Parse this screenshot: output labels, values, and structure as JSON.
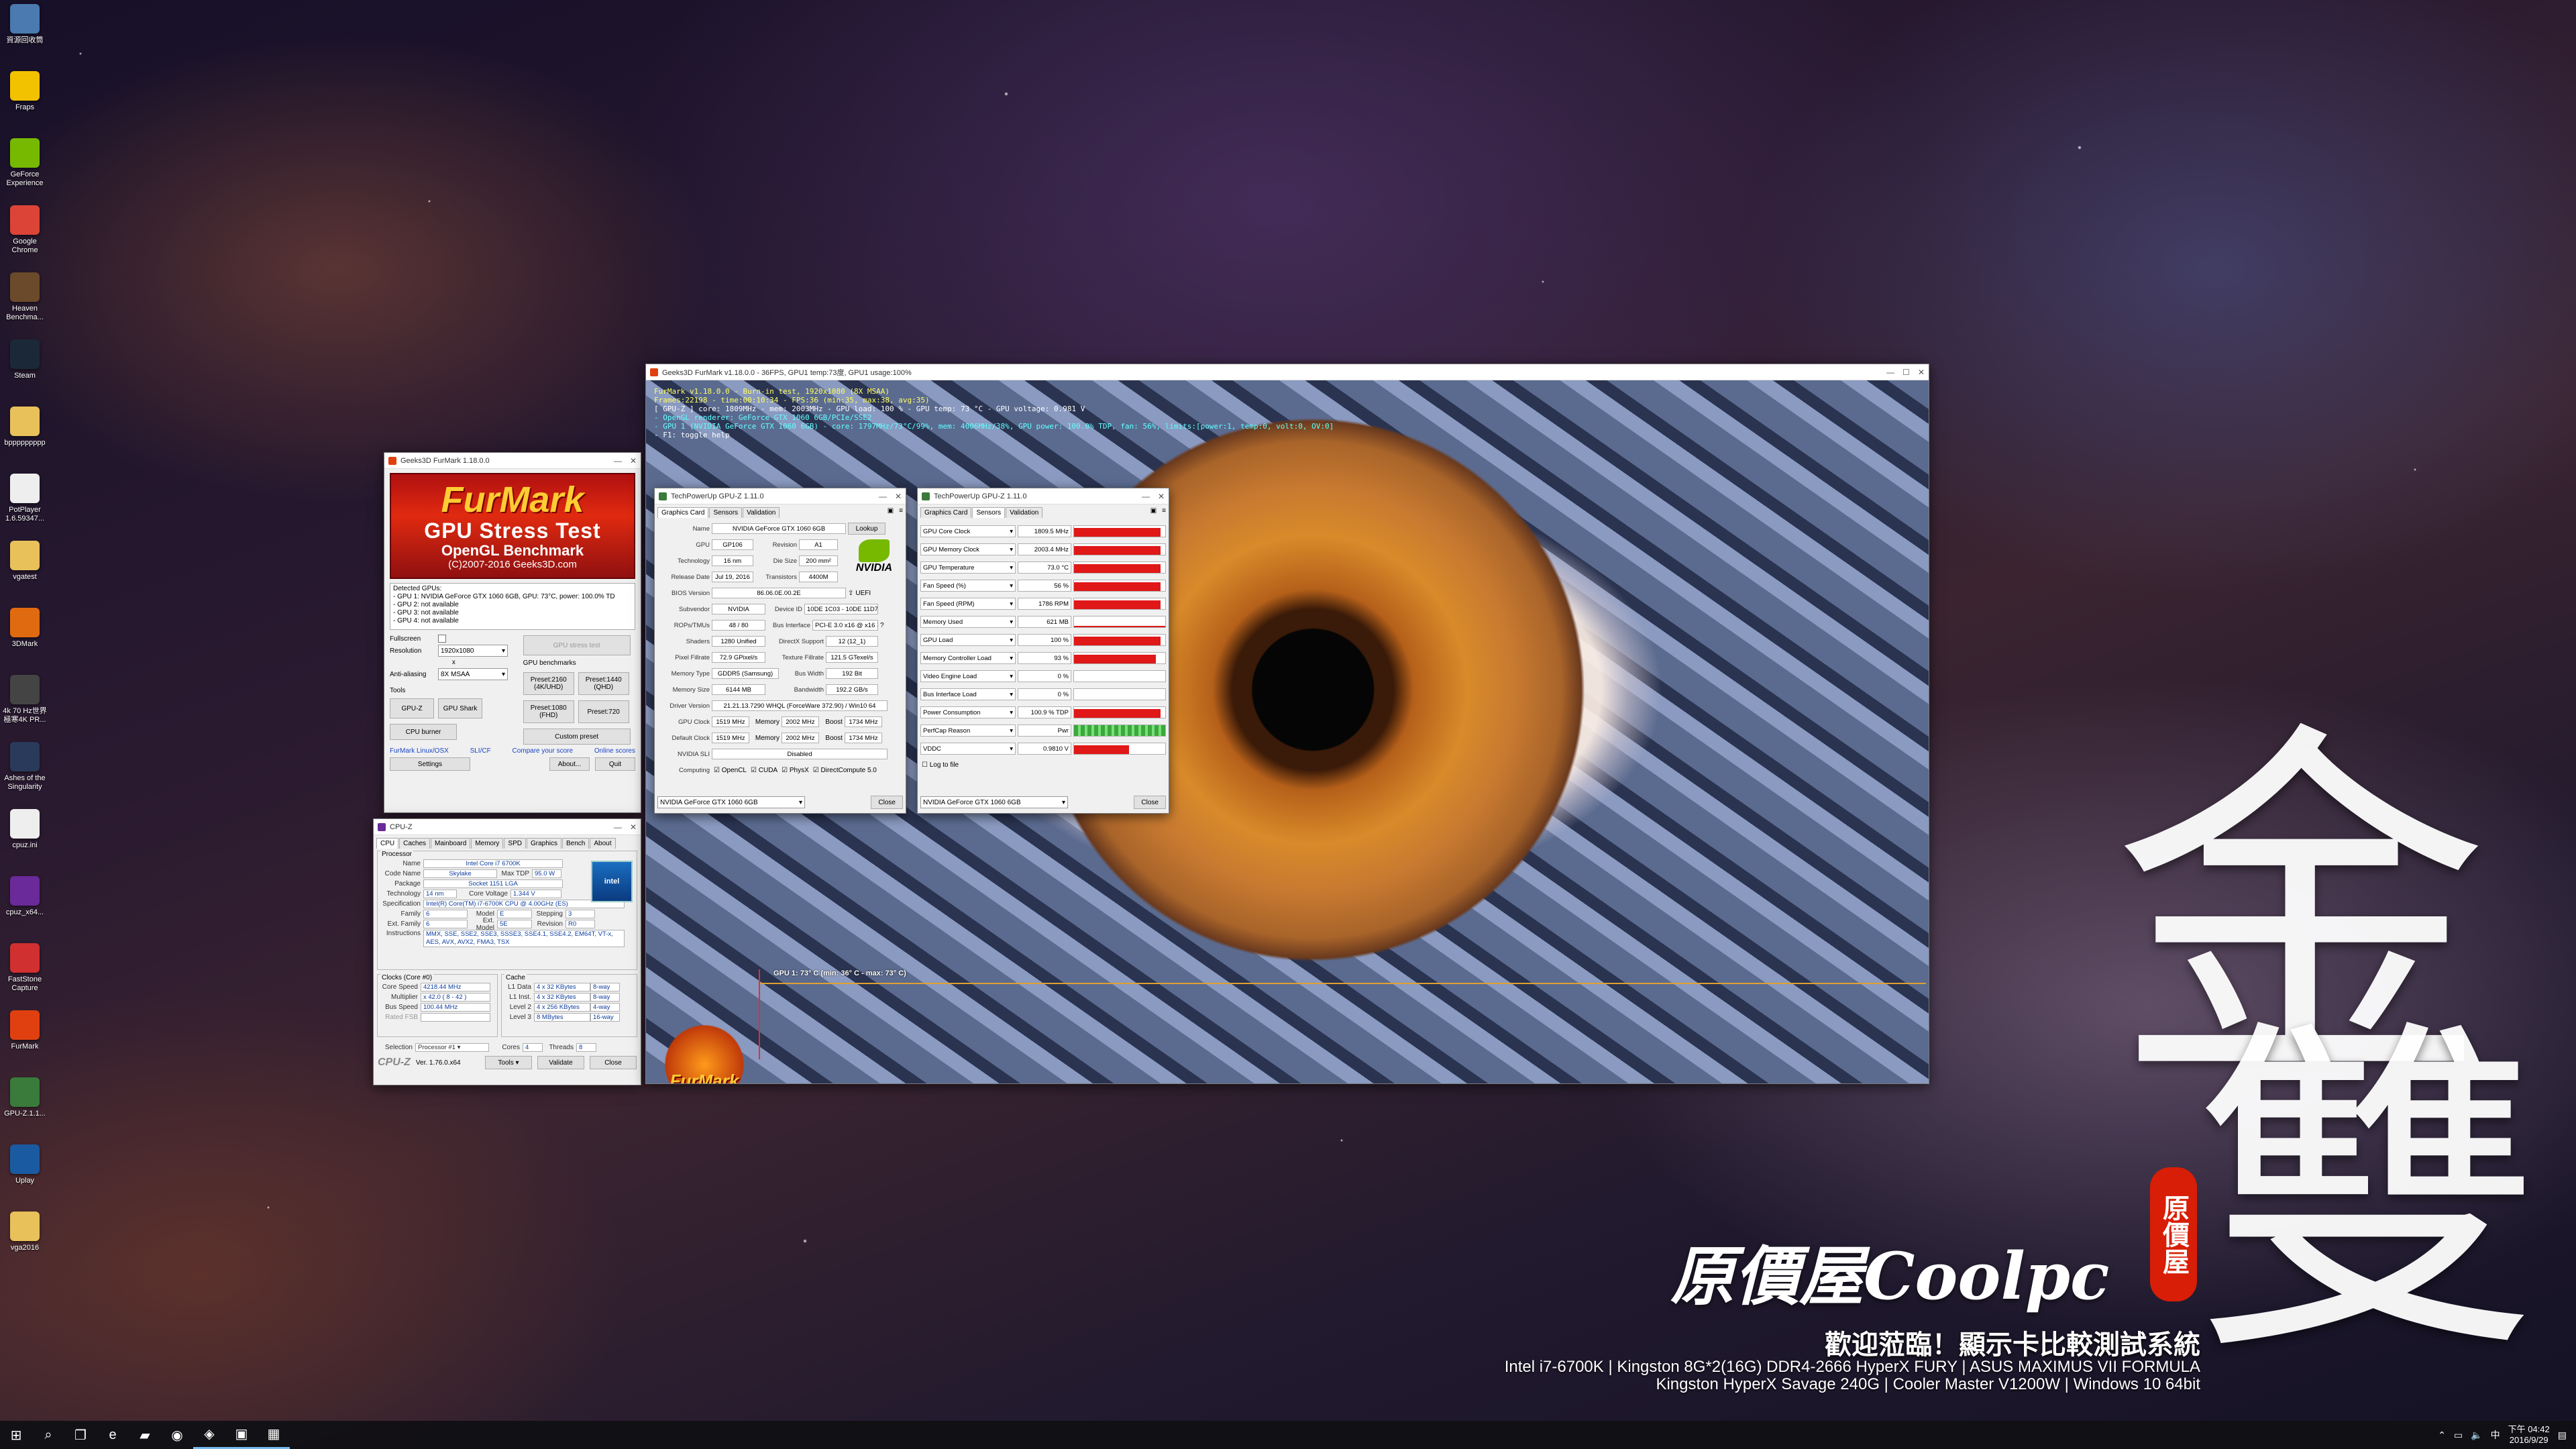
{
  "desktop_icons": [
    {
      "label": "資源回收筒",
      "icon": "recycle-bin-icon",
      "color": "#4a7ab0"
    },
    {
      "label": "Fraps",
      "icon": "fraps-icon",
      "color": "#f2c200"
    },
    {
      "label": "GeForce Experience",
      "icon": "geforce-icon",
      "color": "#76b900"
    },
    {
      "label": "Google Chrome",
      "icon": "chrome-icon",
      "color": "#db4437"
    },
    {
      "label": "Heaven Benchma...",
      "icon": "heaven-icon",
      "color": "#6a4a2a"
    },
    {
      "label": "Steam",
      "icon": "steam-icon",
      "color": "#1b2838"
    },
    {
      "label": "bppppppppp",
      "icon": "folder-icon",
      "color": "#e8c15a"
    },
    {
      "label": "PotPlayer 1.6.59347...",
      "icon": "file-icon",
      "color": "#eeeeee"
    },
    {
      "label": "vgatest",
      "icon": "folder-icon",
      "color": "#e8c15a"
    },
    {
      "label": "3DMark",
      "icon": "3dmark-icon",
      "color": "#e06a10"
    },
    {
      "label": "4k 70 Hz世界 極寒4K PR...",
      "icon": "video-icon",
      "color": "#444444"
    },
    {
      "label": "Ashes of the Singularity",
      "icon": "ashes-icon",
      "color": "#2a3a5a"
    },
    {
      "label": "cpuz.ini",
      "icon": "file-icon",
      "color": "#eeeeee"
    },
    {
      "label": "cpuz_x64...",
      "icon": "cpuz-icon",
      "color": "#6a2a9a"
    },
    {
      "label": "FastStone Capture",
      "icon": "faststone-icon",
      "color": "#d03030"
    },
    {
      "label": "FurMark",
      "icon": "furmark-icon",
      "color": "#e04010"
    },
    {
      "label": "GPU-Z.1.1...",
      "icon": "gpuz-icon",
      "color": "#3a7a3a"
    },
    {
      "label": "Uplay",
      "icon": "uplay-icon",
      "color": "#1a5aa0"
    },
    {
      "label": "vga2016",
      "icon": "folder-icon",
      "color": "#e8c15a"
    }
  ],
  "furmark_launcher": {
    "title": "Geeks3D FurMark 1.18.0.0",
    "banner": {
      "line1": "FurMark",
      "line2": "GPU Stress Test",
      "line3": "OpenGL Benchmark",
      "line4": "(C)2007-2016 Geeks3D.com"
    },
    "gpus_header": "Detected GPUs:",
    "gpus": [
      "- GPU 1: NVIDIA GeForce GTX 1060 6GB, GPU: 73°C, power: 100.0% TD",
      "- GPU 2: not available",
      "- GPU 3: not available",
      "- GPU 4: not available"
    ],
    "fullscreen_label": "Fullscreen",
    "resolution_label": "Resolution",
    "resolution_value": "1920x1080",
    "x_label": "x",
    "antialiasing_label": "Anti-aliasing",
    "antialiasing_value": "8X MSAA",
    "tools_label": "Tools",
    "gpu_stress_test": "GPU stress test",
    "gpu_benchmarks_label": "GPU benchmarks",
    "preset_2160": "Preset:2160 (4K/UHD)",
    "preset_1440": "Preset:1440 (QHD)",
    "preset_1080": "Preset:1080 (FHD)",
    "preset_720": "Preset:720",
    "custom_preset": "Custom preset",
    "gpuz_btn": "GPU-Z",
    "gpushark_btn": "GPU Shark",
    "cpuburner_btn": "CPU burner",
    "links": [
      "FurMark Linux/OSX",
      "SLI/CF",
      "Compare your score",
      "Online scores"
    ],
    "settings_btn": "Settings",
    "about_btn": "About...",
    "quit_btn": "Quit"
  },
  "cpuz": {
    "title": "CPU-Z",
    "tabs": [
      "CPU",
      "Caches",
      "Mainboard",
      "Memory",
      "SPD",
      "Graphics",
      "Bench",
      "About"
    ],
    "processor_label": "Processor",
    "name_label": "Name",
    "name": "Intel Core i7 6700K",
    "codename_label": "Code Name",
    "codename": "Skylake",
    "maxtdp_label": "Max TDP",
    "maxtdp": "95.0 W",
    "package_label": "Package",
    "package": "Socket 1151 LGA",
    "technology_label": "Technology",
    "technology": "14 nm",
    "corevoltage_label": "Core Voltage",
    "corevoltage": "1.344 V",
    "spec_label": "Specification",
    "spec": "Intel(R) Core(TM) i7-6700K CPU @ 4.00GHz (ES)",
    "family_label": "Family",
    "family": "6",
    "model_label": "Model",
    "model": "E",
    "stepping_label": "Stepping",
    "stepping": "3",
    "extfamily_label": "Ext. Family",
    "extfamily": "6",
    "extmodel_label": "Ext. Model",
    "extmodel": "5E",
    "revision_label": "Revision",
    "revision": "R0",
    "instructions_label": "Instructions",
    "instructions": "MMX, SSE, SSE2, SSE3, SSSE3, SSE4.1, SSE4.2, EM64T, VT-x, AES, AVX, AVX2, FMA3, TSX",
    "clocks_label": "Clocks (Core #0)",
    "corespeed_label": "Core Speed",
    "corespeed": "4218.44 MHz",
    "multiplier_label": "Multiplier",
    "multiplier": "x 42.0 ( 8 - 42 )",
    "busspeed_label": "Bus Speed",
    "busspeed": "100.44 MHz",
    "ratedfsb_label": "Rated FSB",
    "cache_label": "Cache",
    "l1d_label": "L1 Data",
    "l1d": "4 x 32 KBytes",
    "l1d_way": "8-way",
    "l1i_label": "L1 Inst.",
    "l1i": "4 x 32 KBytes",
    "l1i_way": "8-way",
    "l2_label": "Level 2",
    "l2": "4 x 256 KBytes",
    "l2_way": "4-way",
    "l3_label": "Level 3",
    "l3": "8 MBytes",
    "l3_way": "16-way",
    "selection_label": "Selection",
    "selection": "Processor #1",
    "cores_label": "Cores",
    "cores": "4",
    "threads_label": "Threads",
    "threads": "8",
    "brand": "CPU-Z",
    "version": "Ver. 1.76.0.x64",
    "tools_btn": "Tools",
    "validate_btn": "Validate",
    "close_btn": "Close"
  },
  "render": {
    "title": "Geeks3D FurMark v1.18.0.0 - 36FPS, GPU1 temp:73度, GPU1 usage:100%",
    "osd": [
      {
        "text": "FurMark v1.18.0.0 - Burn-in test, 1920x1080 (8X MSAA)",
        "color": "#ffff60"
      },
      {
        "text": "Frames:22198 - time:00:10:34 - FPS:36 (min:35, max:38, avg:35)",
        "color": "#ffff60"
      },
      {
        "text": "[ GPU-Z ] core: 1809MHz - mem: 2003MHz - GPU load: 100 % - GPU temp: 73 °C - GPU voltage: 0.981 V",
        "color": "#ffffff"
      },
      {
        "text": "- OpenGL renderer: GeForce GTX 1060 6GB/PCIe/SSE2",
        "color": "#60ffff"
      },
      {
        "text": "- GPU 1 (NVIDIA GeForce GTX 1060 6GB) - core: 1797MHz/73°C/99%, mem: 4006MHz/38%, GPU power: 100.0% TDP, fan: 56%, limits:[power:1, temp:0, volt:0, OV:0]",
        "color": "#60ffff"
      },
      {
        "text": "- F1: toggle help",
        "color": "#ffffff"
      }
    ],
    "graph_label": "GPU 1: 73° C (min: 36° C - max: 73° C)",
    "logo_text": "FurMark"
  },
  "gpuz_card": {
    "title": "TechPowerUp GPU-Z 1.11.0",
    "tabs": [
      "Graphics Card",
      "Sensors",
      "Validation"
    ],
    "name_label": "Name",
    "name": "NVIDIA GeForce GTX 1060 6GB",
    "lookup_btn": "Lookup",
    "gpu_label": "GPU",
    "gpu": "GP106",
    "revision_label": "Revision",
    "revision": "A1",
    "tech_label": "Technology",
    "tech": "16 nm",
    "diesize_label": "Die Size",
    "diesize": "200 mm²",
    "release_label": "Release Date",
    "release": "Jul 19, 2016",
    "transistors_label": "Transistors",
    "transistors": "4400M",
    "bios_label": "BIOS Version",
    "bios": "86.06.0E.00.2E",
    "uefi_label": "UEFI",
    "subvendor_label": "Subvendor",
    "subvendor": "NVIDIA",
    "deviceid_label": "Device ID",
    "deviceid": "10DE 1C03 - 10DE 11D7",
    "rops_label": "ROPs/TMUs",
    "rops": "48 / 80",
    "businterface_label": "Bus Interface",
    "businterface": "PCI-E 3.0 x16 @ x16 3.0",
    "shaders_label": "Shaders",
    "shaders": "1280 Unified",
    "directx_label": "DirectX Support",
    "directx": "12 (12_1)",
    "pixel_label": "Pixel Fillrate",
    "pixel": "72.9 GPixel/s",
    "texture_label": "Texture Fillrate",
    "texture": "121.5 GTexel/s",
    "memtype_label": "Memory Type",
    "memtype": "GDDR5 (Samsung)",
    "buswidth_label": "Bus Width",
    "buswidth": "192 Bit",
    "memsize_label": "Memory Size",
    "memsize": "6144 MB",
    "bandwidth_label": "Bandwidth",
    "bandwidth": "192.2 GB/s",
    "driver_label": "Driver Version",
    "driver": "21.21.13.7290 WHQL (ForceWare 372.90) / Win10 64",
    "gpuclock_label": "GPU Clock",
    "gpuclock": "1519 MHz",
    "memory_label": "Memory",
    "memclock": "2002 MHz",
    "boost_label": "Boost",
    "boost": "1734 MHz",
    "defclock_label": "Default Clock",
    "defclock": "1519 MHz",
    "defmem": "2002 MHz",
    "defboost": "1734 MHz",
    "sli_label": "NVIDIA SLI",
    "sli": "Disabled",
    "computing_label": "Computing",
    "opencl": "OpenCL",
    "cuda": "CUDA",
    "physx": "PhysX",
    "dc": "DirectCompute 5.0",
    "vendor_logo": "NVIDIA",
    "select": "NVIDIA GeForce GTX 1060 6GB",
    "close_btn": "Close"
  },
  "gpuz_sensors": {
    "title": "TechPowerUp GPU-Z 1.11.0",
    "tabs": [
      "Graphics Card",
      "Sensors",
      "Validation"
    ],
    "rows": [
      {
        "label": "GPU Core Clock",
        "value": "1809.5 MHz",
        "level": 0.95,
        "mode": "full"
      },
      {
        "label": "GPU Memory Clock",
        "value": "2003.4 MHz",
        "level": 0.95,
        "mode": "full"
      },
      {
        "label": "GPU Temperature",
        "value": "73.0 °C",
        "level": 0.95,
        "mode": "full"
      },
      {
        "label": "Fan Speed (%)",
        "value": "56 %",
        "level": 0.95,
        "mode": "full"
      },
      {
        "label": "Fan Speed (RPM)",
        "value": "1786 RPM",
        "level": 0.95,
        "mode": "full"
      },
      {
        "label": "Memory Used",
        "value": "621 MB",
        "level": 0.1,
        "mode": "low"
      },
      {
        "label": "GPU Load",
        "value": "100 %",
        "level": 0.95,
        "mode": "full"
      },
      {
        "label": "Memory Controller Load",
        "value": "93 %",
        "level": 0.9,
        "mode": "full"
      },
      {
        "label": "Video Engine Load",
        "value": "0 %",
        "level": 0,
        "mode": "none"
      },
      {
        "label": "Bus Interface Load",
        "value": "0 %",
        "level": 0,
        "mode": "none"
      },
      {
        "label": "Power Consumption",
        "value": "100.9 % TDP",
        "level": 0.95,
        "mode": "full"
      },
      {
        "label": "PerfCap Reason",
        "value": "Pwr",
        "level": 0.95,
        "mode": "perfcap"
      },
      {
        "label": "VDDC",
        "value": "0.9810 V",
        "level": 0.6,
        "mode": "full"
      }
    ],
    "log_label": "Log to file",
    "select": "NVIDIA GeForce GTX 1060 6GB",
    "close_btn": "Close"
  },
  "watermark": {
    "big_char": "金",
    "big_char2": "雙",
    "seal": "原價屋",
    "brand": "原價屋Coolpc",
    "sub": "歡迎蒞臨！顯示卡比較測試系統",
    "spec1": "Intel i7-6700K | Kingston 8G*2(16G) DDR4-2666 HyperX FURY | ASUS MAXIMUS VII FORMULA",
    "spec2": "Kingston HyperX Savage 240G | Cooler Master V1200W | Windows 10 64bit"
  },
  "taskbar": {
    "items": [
      "windows-start-icon",
      "search-icon",
      "task-view-icon",
      "edge-icon",
      "file-explorer-icon",
      "chrome-icon",
      "furmark-icon",
      "cpuz-icon",
      "gpuz-icon"
    ],
    "time": "下午 04:42",
    "date": "2016/9/29"
  },
  "colors": {
    "accent": "#76b9ed",
    "sensor_bar": "#e01818",
    "nvidia_green": "#76b900"
  }
}
